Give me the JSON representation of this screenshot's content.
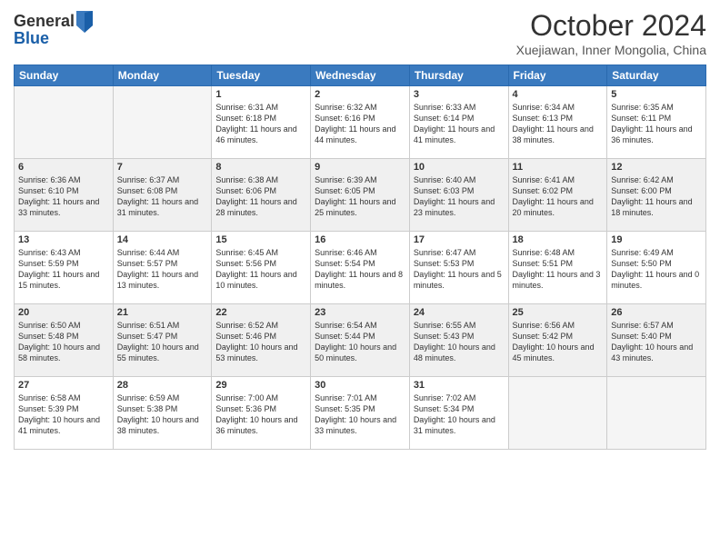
{
  "header": {
    "logo_line1": "General",
    "logo_line2": "Blue",
    "month": "October 2024",
    "location": "Xuejiawan, Inner Mongolia, China"
  },
  "days_of_week": [
    "Sunday",
    "Monday",
    "Tuesday",
    "Wednesday",
    "Thursday",
    "Friday",
    "Saturday"
  ],
  "weeks": [
    [
      {
        "day": "",
        "sunrise": "",
        "sunset": "",
        "daylight": ""
      },
      {
        "day": "",
        "sunrise": "",
        "sunset": "",
        "daylight": ""
      },
      {
        "day": "1",
        "sunrise": "Sunrise: 6:31 AM",
        "sunset": "Sunset: 6:18 PM",
        "daylight": "Daylight: 11 hours and 46 minutes."
      },
      {
        "day": "2",
        "sunrise": "Sunrise: 6:32 AM",
        "sunset": "Sunset: 6:16 PM",
        "daylight": "Daylight: 11 hours and 44 minutes."
      },
      {
        "day": "3",
        "sunrise": "Sunrise: 6:33 AM",
        "sunset": "Sunset: 6:14 PM",
        "daylight": "Daylight: 11 hours and 41 minutes."
      },
      {
        "day": "4",
        "sunrise": "Sunrise: 6:34 AM",
        "sunset": "Sunset: 6:13 PM",
        "daylight": "Daylight: 11 hours and 38 minutes."
      },
      {
        "day": "5",
        "sunrise": "Sunrise: 6:35 AM",
        "sunset": "Sunset: 6:11 PM",
        "daylight": "Daylight: 11 hours and 36 minutes."
      }
    ],
    [
      {
        "day": "6",
        "sunrise": "Sunrise: 6:36 AM",
        "sunset": "Sunset: 6:10 PM",
        "daylight": "Daylight: 11 hours and 33 minutes."
      },
      {
        "day": "7",
        "sunrise": "Sunrise: 6:37 AM",
        "sunset": "Sunset: 6:08 PM",
        "daylight": "Daylight: 11 hours and 31 minutes."
      },
      {
        "day": "8",
        "sunrise": "Sunrise: 6:38 AM",
        "sunset": "Sunset: 6:06 PM",
        "daylight": "Daylight: 11 hours and 28 minutes."
      },
      {
        "day": "9",
        "sunrise": "Sunrise: 6:39 AM",
        "sunset": "Sunset: 6:05 PM",
        "daylight": "Daylight: 11 hours and 25 minutes."
      },
      {
        "day": "10",
        "sunrise": "Sunrise: 6:40 AM",
        "sunset": "Sunset: 6:03 PM",
        "daylight": "Daylight: 11 hours and 23 minutes."
      },
      {
        "day": "11",
        "sunrise": "Sunrise: 6:41 AM",
        "sunset": "Sunset: 6:02 PM",
        "daylight": "Daylight: 11 hours and 20 minutes."
      },
      {
        "day": "12",
        "sunrise": "Sunrise: 6:42 AM",
        "sunset": "Sunset: 6:00 PM",
        "daylight": "Daylight: 11 hours and 18 minutes."
      }
    ],
    [
      {
        "day": "13",
        "sunrise": "Sunrise: 6:43 AM",
        "sunset": "Sunset: 5:59 PM",
        "daylight": "Daylight: 11 hours and 15 minutes."
      },
      {
        "day": "14",
        "sunrise": "Sunrise: 6:44 AM",
        "sunset": "Sunset: 5:57 PM",
        "daylight": "Daylight: 11 hours and 13 minutes."
      },
      {
        "day": "15",
        "sunrise": "Sunrise: 6:45 AM",
        "sunset": "Sunset: 5:56 PM",
        "daylight": "Daylight: 11 hours and 10 minutes."
      },
      {
        "day": "16",
        "sunrise": "Sunrise: 6:46 AM",
        "sunset": "Sunset: 5:54 PM",
        "daylight": "Daylight: 11 hours and 8 minutes."
      },
      {
        "day": "17",
        "sunrise": "Sunrise: 6:47 AM",
        "sunset": "Sunset: 5:53 PM",
        "daylight": "Daylight: 11 hours and 5 minutes."
      },
      {
        "day": "18",
        "sunrise": "Sunrise: 6:48 AM",
        "sunset": "Sunset: 5:51 PM",
        "daylight": "Daylight: 11 hours and 3 minutes."
      },
      {
        "day": "19",
        "sunrise": "Sunrise: 6:49 AM",
        "sunset": "Sunset: 5:50 PM",
        "daylight": "Daylight: 11 hours and 0 minutes."
      }
    ],
    [
      {
        "day": "20",
        "sunrise": "Sunrise: 6:50 AM",
        "sunset": "Sunset: 5:48 PM",
        "daylight": "Daylight: 10 hours and 58 minutes."
      },
      {
        "day": "21",
        "sunrise": "Sunrise: 6:51 AM",
        "sunset": "Sunset: 5:47 PM",
        "daylight": "Daylight: 10 hours and 55 minutes."
      },
      {
        "day": "22",
        "sunrise": "Sunrise: 6:52 AM",
        "sunset": "Sunset: 5:46 PM",
        "daylight": "Daylight: 10 hours and 53 minutes."
      },
      {
        "day": "23",
        "sunrise": "Sunrise: 6:54 AM",
        "sunset": "Sunset: 5:44 PM",
        "daylight": "Daylight: 10 hours and 50 minutes."
      },
      {
        "day": "24",
        "sunrise": "Sunrise: 6:55 AM",
        "sunset": "Sunset: 5:43 PM",
        "daylight": "Daylight: 10 hours and 48 minutes."
      },
      {
        "day": "25",
        "sunrise": "Sunrise: 6:56 AM",
        "sunset": "Sunset: 5:42 PM",
        "daylight": "Daylight: 10 hours and 45 minutes."
      },
      {
        "day": "26",
        "sunrise": "Sunrise: 6:57 AM",
        "sunset": "Sunset: 5:40 PM",
        "daylight": "Daylight: 10 hours and 43 minutes."
      }
    ],
    [
      {
        "day": "27",
        "sunrise": "Sunrise: 6:58 AM",
        "sunset": "Sunset: 5:39 PM",
        "daylight": "Daylight: 10 hours and 41 minutes."
      },
      {
        "day": "28",
        "sunrise": "Sunrise: 6:59 AM",
        "sunset": "Sunset: 5:38 PM",
        "daylight": "Daylight: 10 hours and 38 minutes."
      },
      {
        "day": "29",
        "sunrise": "Sunrise: 7:00 AM",
        "sunset": "Sunset: 5:36 PM",
        "daylight": "Daylight: 10 hours and 36 minutes."
      },
      {
        "day": "30",
        "sunrise": "Sunrise: 7:01 AM",
        "sunset": "Sunset: 5:35 PM",
        "daylight": "Daylight: 10 hours and 33 minutes."
      },
      {
        "day": "31",
        "sunrise": "Sunrise: 7:02 AM",
        "sunset": "Sunset: 5:34 PM",
        "daylight": "Daylight: 10 hours and 31 minutes."
      },
      {
        "day": "",
        "sunrise": "",
        "sunset": "",
        "daylight": ""
      },
      {
        "day": "",
        "sunrise": "",
        "sunset": "",
        "daylight": ""
      }
    ]
  ]
}
